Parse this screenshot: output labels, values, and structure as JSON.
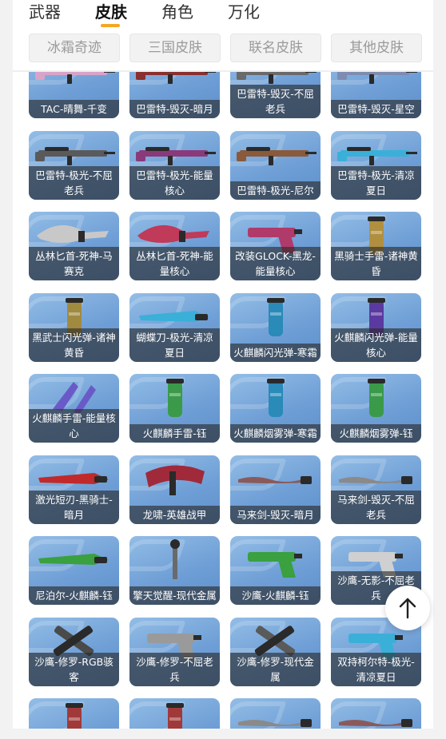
{
  "tabs": [
    {
      "label": "武器",
      "active": false
    },
    {
      "label": "皮肤",
      "active": true
    },
    {
      "label": "角色",
      "active": false
    },
    {
      "label": "万化",
      "active": false
    }
  ],
  "subtabs": [
    "冰霜奇迹",
    "三国皮肤",
    "联名皮肤",
    "其他皮肤"
  ],
  "colors": {
    "accent": "#f5a623",
    "card_top": "#93bde6",
    "card_bottom": "#5f8fca",
    "label_bg": "rgba(40,40,40,0.62)"
  },
  "items": [
    {
      "label": "TAC-晴舞-千变",
      "art": "rifle",
      "color": "#d9a3c8"
    },
    {
      "label": "巴雷特-毁灭-暗月",
      "art": "rifle",
      "color": "#8a2f2f"
    },
    {
      "label": "巴雷特-毁灭-不屈老兵",
      "art": "rifle",
      "color": "#6a6a6a"
    },
    {
      "label": "巴雷特-毁灭-星空",
      "art": "rifle",
      "color": "#7d8cb0"
    },
    {
      "label": "巴雷特-极光-不屈老兵",
      "art": "rifle",
      "color": "#5a5a5a"
    },
    {
      "label": "巴雷特-极光-能量核心",
      "art": "rifle",
      "color": "#8a3a7a"
    },
    {
      "label": "巴雷特-极光-尼尔",
      "art": "rifle",
      "color": "#8a5a3a"
    },
    {
      "label": "巴雷特-极光-清凉夏日",
      "art": "rifle",
      "color": "#3ab0d8"
    },
    {
      "label": "丛林匕首-死神-马赛克",
      "art": "blade",
      "color": "#c8c8c8"
    },
    {
      "label": "丛林匕首-死神-能量核心",
      "art": "blade",
      "color": "#c03a5a"
    },
    {
      "label": "改装GLOCK-黑龙-能量核心",
      "art": "pistol",
      "color": "#b03a6a"
    },
    {
      "label": "黑骑士手雷-诸神黄昏",
      "art": "grenade",
      "color": "#b09040"
    },
    {
      "label": "黑武士闪光弹-诸神黄昏",
      "art": "grenade",
      "color": "#a08a40"
    },
    {
      "label": "蝴蝶刀-极光-清凉夏日",
      "art": "knife",
      "color": "#3ab0d8"
    },
    {
      "label": "火麒麟闪光弹-寒霜",
      "art": "grenade",
      "color": "#2a8ab8"
    },
    {
      "label": "火麒麟闪光弹-能量核心",
      "art": "grenade",
      "color": "#5a3aa0"
    },
    {
      "label": "火麒麟手雷-能量核心",
      "art": "claw",
      "color": "#6a5ac8"
    },
    {
      "label": "火麒麟手雷-钰",
      "art": "grenade",
      "color": "#3a9a4a"
    },
    {
      "label": "火麒麟烟雾弹-寒霜",
      "art": "grenade",
      "color": "#2a8ab8"
    },
    {
      "label": "火麒麟烟雾弹-钰",
      "art": "grenade",
      "color": "#3a9a4a"
    },
    {
      "label": "激光短刃-黑骑士-暗月",
      "art": "knife",
      "color": "#c02a2a"
    },
    {
      "label": "龙啸-英雄战甲",
      "art": "axe",
      "color": "#a02a3a"
    },
    {
      "label": "马来剑-毁灭-暗月",
      "art": "sword",
      "color": "#8a5a5a"
    },
    {
      "label": "马来剑-毁灭-不屈老兵",
      "art": "sword",
      "color": "#8a8a8a"
    },
    {
      "label": "尼泊尔-火麒麟-钰",
      "art": "knife",
      "color": "#3aa040"
    },
    {
      "label": "擎天觉醒-现代金属",
      "art": "staff",
      "color": "#6a6a6a"
    },
    {
      "label": "沙鹰-火麒麟-钰",
      "art": "pistol",
      "color": "#3aa040"
    },
    {
      "label": "沙鹰-无影-不屈老兵",
      "art": "pistol",
      "color": "#d0d0d0"
    },
    {
      "label": "沙鹰-修罗-RGB骇客",
      "art": "dual",
      "color": "#4a4a4a"
    },
    {
      "label": "沙鹰-修罗-不屈老兵",
      "art": "pistol",
      "color": "#9a9a9a"
    },
    {
      "label": "沙鹰-修罗-现代金属",
      "art": "dual",
      "color": "#5a5a5a"
    },
    {
      "label": "双持柯尔特-极光-清凉夏日",
      "art": "pistol",
      "color": "#3ab0d8"
    },
    {
      "label": "",
      "art": "grenade",
      "color": "#a03a3a"
    },
    {
      "label": "",
      "art": "grenade",
      "color": "#a03a3a"
    },
    {
      "label": "",
      "art": "sword",
      "color": "#8a8a8a"
    },
    {
      "label": "",
      "art": "sword",
      "color": "#8a5a5a"
    }
  ]
}
